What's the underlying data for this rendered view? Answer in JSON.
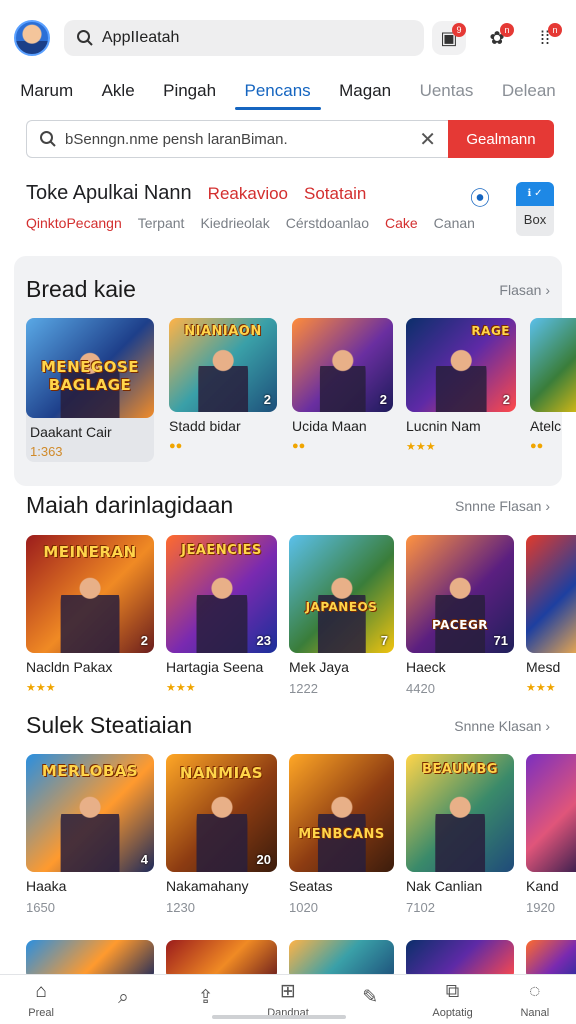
{
  "header": {
    "search_text": "AppIIeatah",
    "icons": [
      {
        "name": "app-badge-icon",
        "badge": "9"
      },
      {
        "name": "game-controller-icon",
        "badge": "n"
      },
      {
        "name": "more-dots-icon",
        "badge": "n"
      }
    ]
  },
  "tabs": [
    {
      "label": "Marum",
      "state": "normal"
    },
    {
      "label": "Akle",
      "state": "normal"
    },
    {
      "label": "Pingah",
      "state": "normal"
    },
    {
      "label": "Pencans",
      "state": "active"
    },
    {
      "label": "Magan",
      "state": "normal"
    },
    {
      "label": "Uentas",
      "state": "dim"
    },
    {
      "label": "Delean",
      "state": "dim"
    }
  ],
  "filter": {
    "text": "bSenngn.nme pensh laranBiman.",
    "button_label": "Gealmann"
  },
  "store": {
    "title": "Toke Apulkai Nann",
    "red1": "Reakavioo",
    "red2": "Sotatain",
    "sub": [
      "QinktoPecangn",
      "Terpant",
      "Kiedrieolak",
      "Cérstdoanlao",
      "Cake",
      "Canan"
    ],
    "box_top": "ℹ ✓",
    "box_label": "Box"
  },
  "sections": [
    {
      "title": "Bread kaie",
      "more": "Flasan",
      "cards": [
        {
          "name": "Daakant Cair",
          "meta": "1:363",
          "art_text": "MENEGOSE BAGLAGE",
          "num": "",
          "stars": ""
        },
        {
          "name": "Stadd bidar",
          "meta": "",
          "art_text": "NIANIAON",
          "num": "2",
          "stars": "●●"
        },
        {
          "name": "Ucida Maan",
          "meta": "",
          "art_text": "",
          "num": "2",
          "stars": "●●"
        },
        {
          "name": "Lucnin Nam",
          "meta": "",
          "art_text": "RAGE",
          "num": "2",
          "stars": "★★★"
        },
        {
          "name": "Atelc",
          "meta": "",
          "art_text": "",
          "num": "",
          "stars": "●●"
        }
      ]
    },
    {
      "title": "Maiah darinlagidaan",
      "more": "Snnne Flasan",
      "cards": [
        {
          "name": "Nacldn Pakax",
          "meta": "",
          "art_text": "MEINERAN",
          "num": "2",
          "stars": "★★★"
        },
        {
          "name": "Hartagia Seena",
          "meta": "",
          "art_text": "JEAENCIES",
          "num": "23",
          "stars": "★★★"
        },
        {
          "name": "Mek Jaya",
          "meta": "1222",
          "art_text": "JAPANEOS",
          "num": "7",
          "stars": ""
        },
        {
          "name": "Haeck",
          "meta": "4420",
          "art_text": "PACEGR",
          "num": "71",
          "stars": ""
        },
        {
          "name": "Mesd",
          "meta": "",
          "art_text": "",
          "num": "",
          "stars": "★★★"
        }
      ]
    },
    {
      "title": "Sulek Steatiaian",
      "more": "Snnne Klasan",
      "cards": [
        {
          "name": "Haaka",
          "meta": "1650",
          "art_text": "MERLOBAS",
          "num": "4",
          "stars": ""
        },
        {
          "name": "Nakamahany",
          "meta": "1230",
          "art_text": "NANMIAS",
          "num": "20",
          "stars": ""
        },
        {
          "name": "Seatas",
          "meta": "1020",
          "art_text": "MENBCANS",
          "num": "",
          "stars": ""
        },
        {
          "name": "Nak Canlian",
          "meta": "7102",
          "art_text": "BEAUMBG",
          "num": "",
          "stars": ""
        },
        {
          "name": "Kand",
          "meta": "1920",
          "art_text": "",
          "num": "",
          "stars": ""
        }
      ]
    }
  ],
  "bottom_nav": [
    {
      "icon": "home-icon",
      "label": "Preal",
      "glyph": "⌂"
    },
    {
      "icon": "search-icon",
      "label": "",
      "glyph": "⌕"
    },
    {
      "icon": "upload-icon",
      "label": "",
      "glyph": "⇪"
    },
    {
      "icon": "add-icon",
      "label": "Dandnat",
      "glyph": "⊞"
    },
    {
      "icon": "chat-icon",
      "label": "",
      "glyph": "✎"
    },
    {
      "icon": "apps-icon",
      "label": "Aoptatig",
      "glyph": "⧉"
    },
    {
      "icon": "profile-icon",
      "label": "Nanal",
      "glyph": "◌"
    }
  ]
}
